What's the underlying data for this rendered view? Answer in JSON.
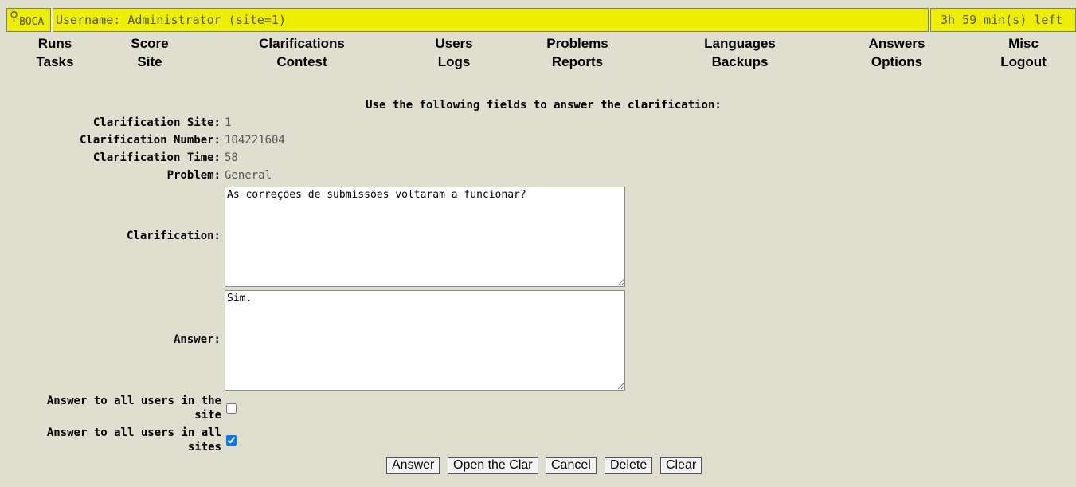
{
  "header": {
    "logo_text": "BOCA",
    "username_text": "Username: Administrator (site=1)",
    "time_left": "3h 59 min(s) left"
  },
  "menu": {
    "row1": [
      "Runs",
      "Score",
      "Clarifications",
      "Users",
      "Problems",
      "Languages",
      "Answers",
      "Misc"
    ],
    "row2": [
      "Tasks",
      "Site",
      "Contest",
      "Logs",
      "Reports",
      "Backups",
      "Options",
      "Logout"
    ]
  },
  "form": {
    "heading": "Use the following fields to answer the clarification:",
    "site_label": "Clarification Site:",
    "site_value": "1",
    "number_label": "Clarification Number:",
    "number_value": "104221604",
    "time_label": "Clarification Time:",
    "time_value": "58",
    "problem_label": "Problem:",
    "problem_value": "General",
    "clarification_label": "Clarification:",
    "clarification_text": "As correções de submissões voltaram a funcionar?",
    "answer_label": "Answer:",
    "answer_text": "Sim.",
    "all_site_label": "Answer to all users in the site",
    "all_site_checked": false,
    "all_sites_label": "Answer to all users in all sites",
    "all_sites_checked": true
  },
  "buttons": {
    "answer": "Answer",
    "open": "Open the Clar",
    "cancel": "Cancel",
    "delete": "Delete",
    "clear": "Clear"
  }
}
